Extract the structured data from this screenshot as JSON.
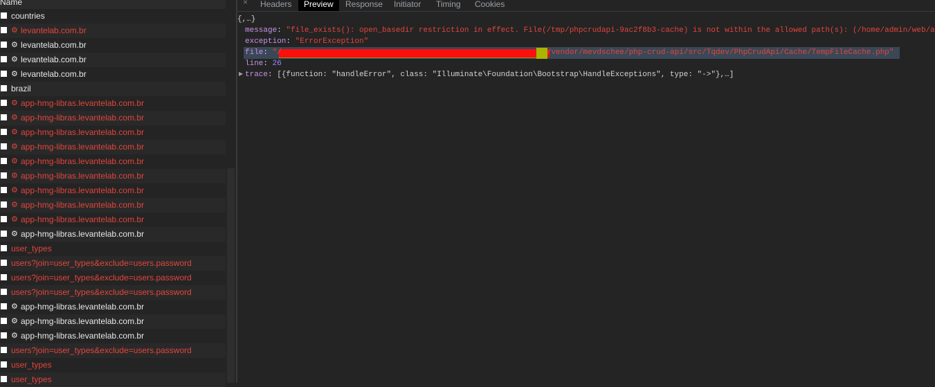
{
  "left_header": "Name",
  "requests": [
    {
      "name": "countries",
      "gear": false,
      "red": false
    },
    {
      "name": "levantelab.com.br",
      "gear": true,
      "red": true
    },
    {
      "name": "levantelab.com.br",
      "gear": true,
      "red": false
    },
    {
      "name": "levantelab.com.br",
      "gear": true,
      "red": false
    },
    {
      "name": "levantelab.com.br",
      "gear": true,
      "red": false
    },
    {
      "name": "brazil",
      "gear": false,
      "red": false
    },
    {
      "name": "app-hmg-libras.levantelab.com.br",
      "gear": true,
      "red": true
    },
    {
      "name": "app-hmg-libras.levantelab.com.br",
      "gear": true,
      "red": true
    },
    {
      "name": "app-hmg-libras.levantelab.com.br",
      "gear": true,
      "red": true
    },
    {
      "name": "app-hmg-libras.levantelab.com.br",
      "gear": true,
      "red": true
    },
    {
      "name": "app-hmg-libras.levantelab.com.br",
      "gear": true,
      "red": true
    },
    {
      "name": "app-hmg-libras.levantelab.com.br",
      "gear": true,
      "red": true
    },
    {
      "name": "app-hmg-libras.levantelab.com.br",
      "gear": true,
      "red": true
    },
    {
      "name": "app-hmg-libras.levantelab.com.br",
      "gear": true,
      "red": true
    },
    {
      "name": "app-hmg-libras.levantelab.com.br",
      "gear": true,
      "red": true
    },
    {
      "name": "app-hmg-libras.levantelab.com.br",
      "gear": true,
      "red": false
    },
    {
      "name": "user_types",
      "gear": false,
      "red": true
    },
    {
      "name": "users?join=user_types&exclude=users.password",
      "gear": false,
      "red": true
    },
    {
      "name": "users?join=user_types&exclude=users.password",
      "gear": false,
      "red": true
    },
    {
      "name": "users?join=user_types&exclude=users.password",
      "gear": false,
      "red": true
    },
    {
      "name": "app-hmg-libras.levantelab.com.br",
      "gear": true,
      "red": false
    },
    {
      "name": "app-hmg-libras.levantelab.com.br",
      "gear": true,
      "red": false
    },
    {
      "name": "app-hmg-libras.levantelab.com.br",
      "gear": true,
      "red": false
    },
    {
      "name": "users?join=user_types&exclude=users.password",
      "gear": false,
      "red": true
    },
    {
      "name": "user_types",
      "gear": false,
      "red": true
    },
    {
      "name": "user_types",
      "gear": false,
      "red": true
    }
  ],
  "gear_icon": "⚙",
  "tabs": {
    "close": "×",
    "headers": "Headers",
    "preview": "Preview",
    "response": "Response",
    "initiator": "Initiator",
    "timing": "Timing",
    "cookies": "Cookies"
  },
  "preview": {
    "root": "{,…}",
    "message_key": "message",
    "message_value": "\"file_exists(): open_basedir restriction in effect. File(/tmp/phpcrudapi-9ac2f8b3-cache) is not within the allowed path(s): (/home/admin/web/a",
    "exception_key": "exception",
    "exception_value": "\"ErrorException\"",
    "file_key": "file",
    "file_value_start": "\"/",
    "file_value_end": "/vendor/mevdschee/php-crud-api/src/Tqdev/PhpCrudApi/Cache/TempFileCache.php\"",
    "line_key": "line",
    "line_value": "26",
    "trace_key": "trace",
    "trace_value": "[{function: \"handleError\", class: \"Illuminate\\Foundation\\Bootstrap\\HandleExceptions\", type: \"->\"},…]"
  },
  "colors": {
    "error": "#e2453c",
    "key": "#c792ea",
    "number": "#9a8cff"
  }
}
